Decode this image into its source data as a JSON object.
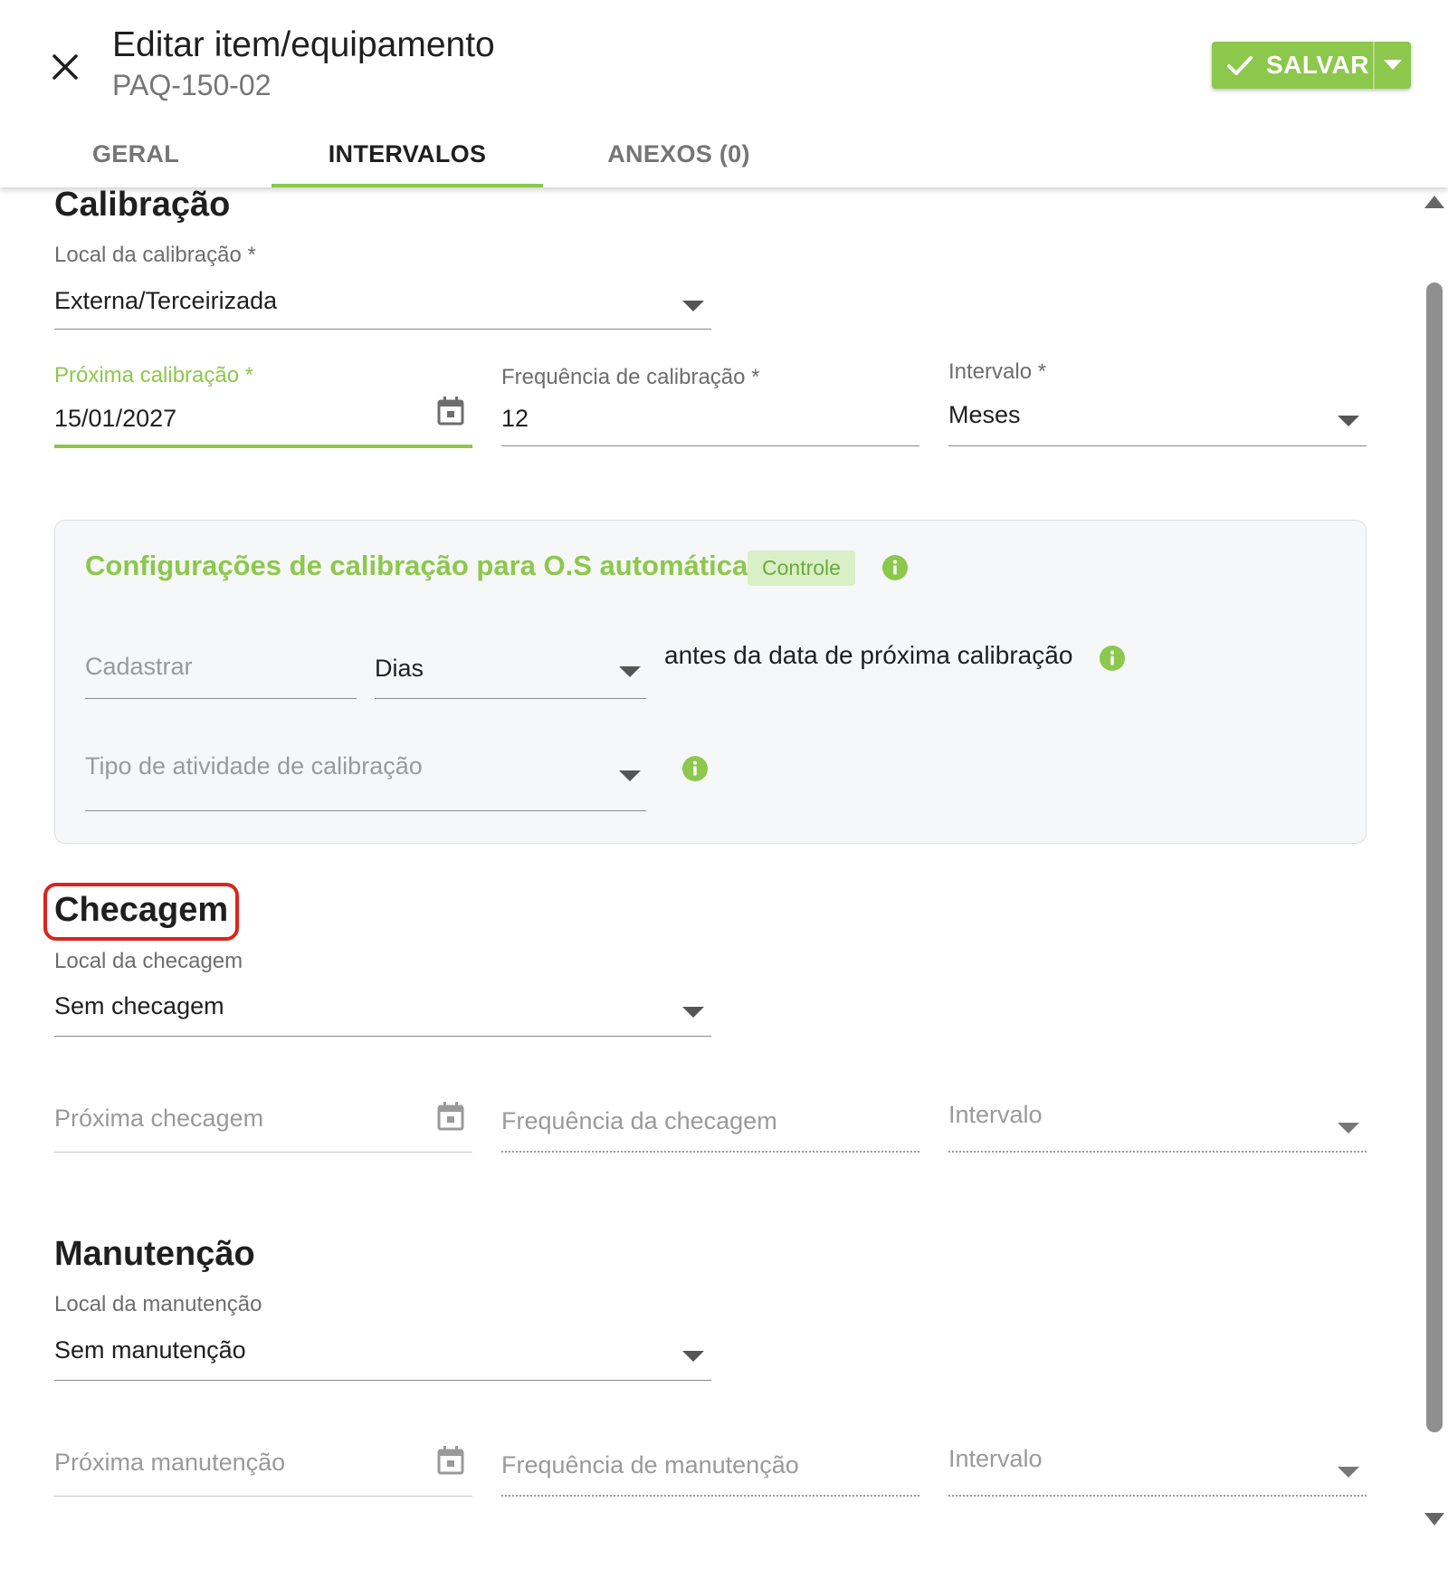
{
  "header": {
    "title": "Editar item/equipamento",
    "subtitle": "PAQ-150-02",
    "save_label": "SALVAR"
  },
  "tabs": [
    {
      "label": "GERAL",
      "active": false
    },
    {
      "label": "INTERVALOS",
      "active": true
    },
    {
      "label": "ANEXOS (0)",
      "active": false
    }
  ],
  "calibracao": {
    "title": "Calibração",
    "local_label": "Local da calibração *",
    "local_value": "Externa/Terceirizada",
    "proxima_label": "Próxima calibração *",
    "proxima_value": "15/01/2027",
    "frequencia_label": "Frequência de calibração *",
    "frequencia_value": "12",
    "intervalo_label": "Intervalo *",
    "intervalo_value": "Meses"
  },
  "os_config": {
    "title": "Configurações de calibração para O.S automática",
    "badge": "Controle",
    "cadastrar_placeholder": "Cadastrar",
    "unidade_value": "Dias",
    "antes_text": "antes da data de próxima calibração",
    "tipo_placeholder": "Tipo de atividade de calibração"
  },
  "checagem": {
    "title": "Checagem",
    "local_label": "Local da checagem",
    "local_value": "Sem checagem",
    "proxima_placeholder": "Próxima checagem",
    "frequencia_placeholder": "Frequência da checagem",
    "intervalo_placeholder": "Intervalo"
  },
  "manutencao": {
    "title": "Manutenção",
    "local_label": "Local da manutenção",
    "local_value": "Sem manutenção",
    "proxima_placeholder": "Próxima manutenção",
    "frequencia_placeholder": "Frequência de manutenção",
    "intervalo_placeholder": "Intervalo"
  },
  "colors": {
    "accent": "#8cc84b",
    "highlight": "#d8261f",
    "panel_bg": "#f6f7f8"
  },
  "icons": [
    "close-icon",
    "check-icon",
    "chevron-down-icon",
    "calendar-icon",
    "info-icon",
    "scroll-up-icon",
    "scroll-down-icon"
  ]
}
